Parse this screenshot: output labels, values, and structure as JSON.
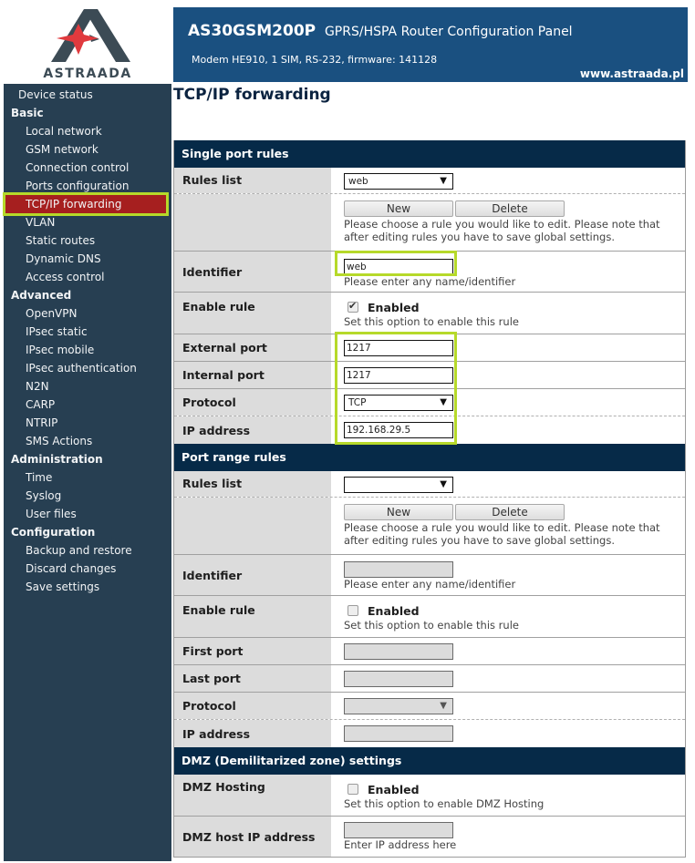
{
  "logo": {
    "text": "ASTRAADA",
    "icon": "astraada-logo-icon"
  },
  "header": {
    "model": "AS30GSM200P",
    "subtitle": "GPRS/HSPA Router Configuration Panel",
    "modem_info": "Modem HE910, 1 SIM, RS-232, firmware: 141128",
    "url": "www.astraada.pl"
  },
  "sidebar": {
    "items": [
      {
        "label": "Device status",
        "type": "item0"
      },
      {
        "label": "Basic",
        "type": "group"
      },
      {
        "label": "Local network",
        "type": "item"
      },
      {
        "label": "GSM network",
        "type": "item"
      },
      {
        "label": "Connection control",
        "type": "item"
      },
      {
        "label": "Ports configuration",
        "type": "item"
      },
      {
        "label": "TCP/IP forwarding",
        "type": "item",
        "active": true
      },
      {
        "label": "VLAN",
        "type": "item"
      },
      {
        "label": "Static routes",
        "type": "item"
      },
      {
        "label": "Dynamic DNS",
        "type": "item"
      },
      {
        "label": "Access control",
        "type": "item"
      },
      {
        "label": "Advanced",
        "type": "group"
      },
      {
        "label": "OpenVPN",
        "type": "item"
      },
      {
        "label": "IPsec static",
        "type": "item"
      },
      {
        "label": "IPsec mobile",
        "type": "item"
      },
      {
        "label": "IPsec authentication",
        "type": "item"
      },
      {
        "label": "N2N",
        "type": "item"
      },
      {
        "label": "CARP",
        "type": "item"
      },
      {
        "label": "NTRIP",
        "type": "item"
      },
      {
        "label": "SMS Actions",
        "type": "item"
      },
      {
        "label": "Administration",
        "type": "group"
      },
      {
        "label": "Time",
        "type": "item"
      },
      {
        "label": "Syslog",
        "type": "item"
      },
      {
        "label": "User files",
        "type": "item"
      },
      {
        "label": "Configuration",
        "type": "group"
      },
      {
        "label": "Backup and restore",
        "type": "item"
      },
      {
        "label": "Discard changes",
        "type": "item"
      },
      {
        "label": "Save settings",
        "type": "item"
      }
    ]
  },
  "page": {
    "title": "TCP/IP forwarding"
  },
  "single": {
    "heading": "Single port rules",
    "rules_list_label": "Rules list",
    "rules_list_value": "web",
    "new_label": "New",
    "delete_label": "Delete",
    "rules_help": "Please choose a rule you would like to edit. Please note that after editing rules you have to save global settings.",
    "identifier_label": "Identifier",
    "identifier_value": "web",
    "identifier_help": "Please enter any name/identifier",
    "enable_label": "Enable rule",
    "enabled_text": "Enabled",
    "enabled_checked": true,
    "enable_help": "Set this option to enable this rule",
    "external_port_label": "External port",
    "external_port_value": "1217",
    "internal_port_label": "Internal port",
    "internal_port_value": "1217",
    "protocol_label": "Protocol",
    "protocol_value": "TCP",
    "ip_label": "IP address",
    "ip_value": "192.168.29.5"
  },
  "range": {
    "heading": "Port range rules",
    "rules_list_label": "Rules list",
    "rules_list_value": "",
    "new_label": "New",
    "delete_label": "Delete",
    "rules_help": "Please choose a rule you would like to edit. Please note that after editing rules you have to save global settings.",
    "identifier_label": "Identifier",
    "identifier_value": "",
    "identifier_help": "Please enter any name/identifier",
    "enable_label": "Enable rule",
    "enabled_text": "Enabled",
    "enabled_checked": false,
    "enable_help": "Set this option to enable this rule",
    "first_port_label": "First port",
    "first_port_value": "",
    "last_port_label": "Last port",
    "last_port_value": "",
    "protocol_label": "Protocol",
    "protocol_value": "",
    "ip_label": "IP address",
    "ip_value": ""
  },
  "dmz": {
    "heading": "DMZ (Demilitarized zone) settings",
    "hosting_label": "DMZ Hosting",
    "enabled_text": "Enabled",
    "enabled_checked": false,
    "hosting_help": "Set this option to enable DMZ Hosting",
    "host_ip_label": "DMZ host IP address",
    "host_ip_value": "",
    "host_ip_help": "Enter IP address here"
  },
  "colors": {
    "header_bg": "#1a5080",
    "sidebar_bg": "#273f52",
    "section_bg": "#062a48",
    "active_item_bg": "#a61f1f",
    "highlight": "#b6d92a",
    "logo_red": "#e03a3e",
    "logo_dark": "#3c4b55"
  }
}
